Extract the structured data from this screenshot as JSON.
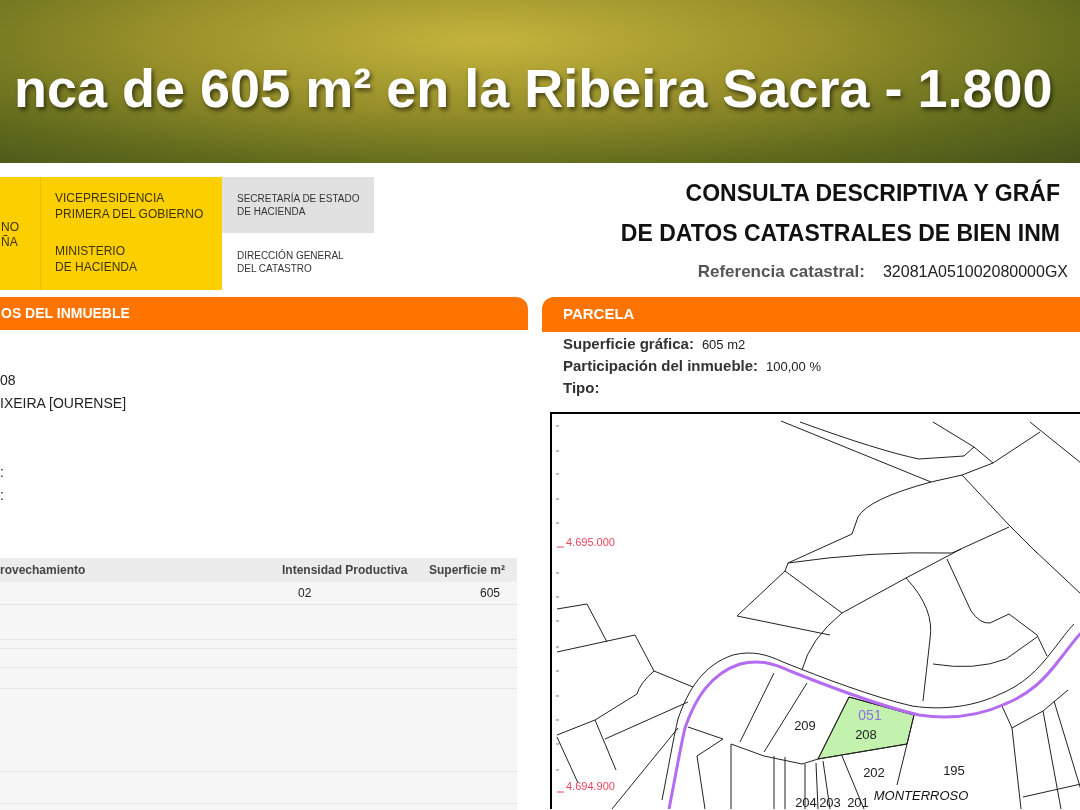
{
  "slide_title": "nca de 605 m² en la Ribeira Sacra - 1.800",
  "logo": {
    "crest_text": [
      "NO",
      "ÑA"
    ],
    "ministry_texts": [
      [
        "VICEPRESIDENCIA",
        "PRIMERA DEL GOBIERNO"
      ],
      [
        "MINISTERIO",
        "DE HACIENDA"
      ]
    ],
    "departments": [
      {
        "kind": "shaded",
        "lines": [
          "SECRETARÍA DE ESTADO",
          "DE HACIENDA"
        ]
      },
      {
        "kind": "plain",
        "lines": [
          "DIRECCIÓN GENERAL",
          "DEL CATASTRO"
        ]
      }
    ]
  },
  "document_header": {
    "title_lines": [
      "CONSULTA DESCRIPTIVA Y GRÁF",
      "DE DATOS CATASTRALES DE BIEN INM"
    ],
    "reference_label": "Referencia catastral:",
    "reference_value": "32081A051002080000GX"
  },
  "property_panel": {
    "title": "OS DEL INMUEBLE",
    "lines": [
      "08",
      "IXEIRA [OURENSE]",
      ":",
      ":"
    ],
    "table": {
      "columns": [
        "rovechamiento",
        "Intensidad Productiva",
        "Superficie m²"
      ],
      "rows": [
        {
          "intensidad_productiva": "02",
          "superficie": "605"
        }
      ]
    }
  },
  "parcel_panel": {
    "title": "PARCELA",
    "fields": [
      {
        "label": "Superficie gráfica:",
        "value": "605 m2"
      },
      {
        "label": "Participación del inmueble:",
        "value": "100,00 %"
      },
      {
        "label": "Tipo:"
      }
    ],
    "map": {
      "coordinate_labels": [
        "4.695.000",
        "4.694.900"
      ],
      "polygon_label": "051",
      "parcels": [
        {
          "label": "209",
          "highlighted": false
        },
        {
          "label": "208",
          "highlighted": true
        },
        {
          "label": "202",
          "highlighted": false
        },
        {
          "label": "195",
          "highlighted": false
        },
        {
          "label": "204",
          "highlighted": false
        },
        {
          "label": "203",
          "highlighted": false
        },
        {
          "label": "201",
          "highlighted": false
        }
      ],
      "place_label": "MONTERROSO"
    }
  }
}
